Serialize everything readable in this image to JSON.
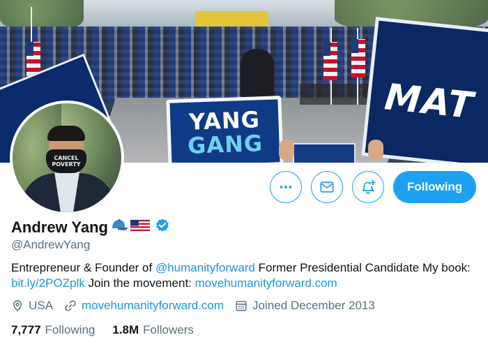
{
  "banner": {
    "sign_main_line1": "YANG",
    "sign_main_line2": "GANG",
    "sign_right_text": "MAT"
  },
  "avatar": {
    "mask_line1": "CANCEL",
    "mask_line2": "POVERTY"
  },
  "actions": {
    "more_icon": "more-dots-icon",
    "message_icon": "envelope-icon",
    "notify_icon": "bell-plus-icon",
    "follow_label": "Following"
  },
  "profile": {
    "name": "Andrew Yang",
    "badges": [
      "blue-cap-emoji",
      "us-flag-emoji",
      "verified-badge"
    ],
    "handle": "@AndrewYang",
    "bio": {
      "part1": "Entrepreneur & Founder of ",
      "mention": "@humanityforward",
      "part2": " Former Presidential Candidate My book: ",
      "book_link": "bit.ly/2POZplk",
      "part3": " Join the movement: ",
      "movement_link": "movehumanityforward.com"
    },
    "meta": {
      "location": "USA",
      "website": "movehumanityforward.com",
      "joined": "Joined December 2013"
    },
    "stats": {
      "following_count": "7,777",
      "following_label": "Following",
      "followers_count": "1.8M",
      "followers_label": "Followers"
    }
  },
  "colors": {
    "accent": "#1da1f2",
    "link": "#1b95e0",
    "secondary_text": "#5b7083",
    "primary_text": "#0f1419"
  }
}
